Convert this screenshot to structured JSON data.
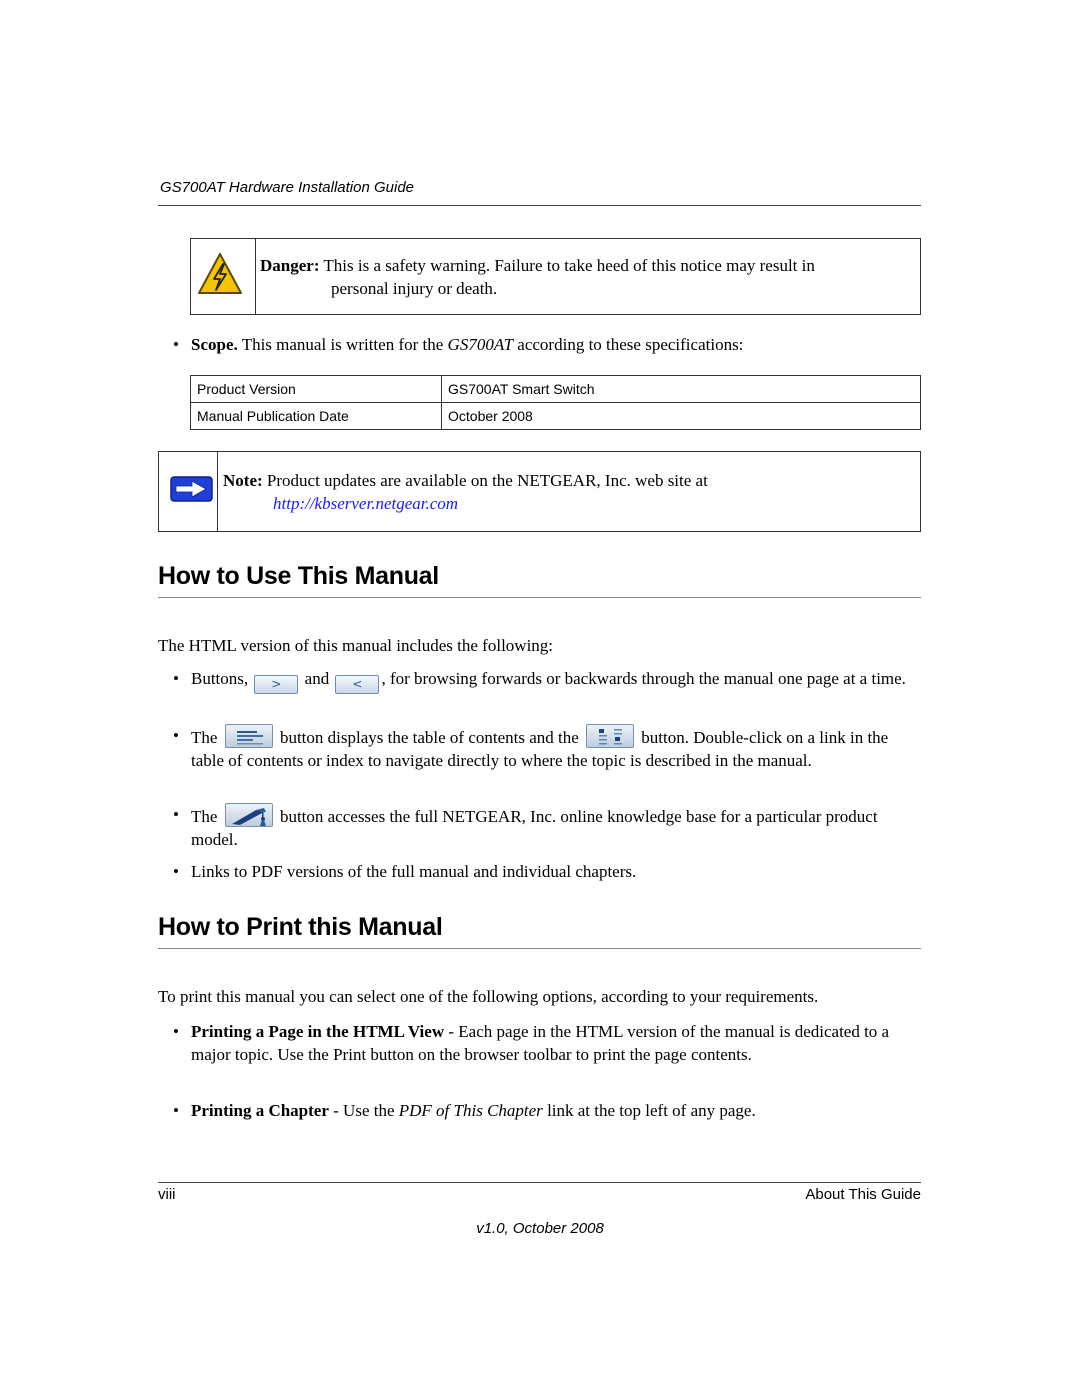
{
  "header": {
    "title": "GS700AT Hardware Installation Guide"
  },
  "danger": {
    "icon": "high-voltage-warning-icon",
    "label": "Danger:",
    "line1": " This is a safety warning. Failure to take heed of this notice may result in",
    "line2": "personal injury or death."
  },
  "scope": {
    "bullet": "•",
    "label": "Scope.",
    "text_before": " This manual is written for the ",
    "product": "GS700AT",
    "text_after": " according to these specifications:"
  },
  "spec_table": {
    "rows": [
      {
        "label": "Product Version",
        "value": "GS700AT Smart Switch"
      },
      {
        "label": "Manual Publication Date",
        "value": "October 2008"
      }
    ]
  },
  "note": {
    "icon": "arrow-right-icon",
    "label": "Note:",
    "text": " Product updates are available on the NETGEAR, Inc. web site at",
    "link": "http://kbserver.netgear.com"
  },
  "section_use": {
    "heading": "How to Use This Manual",
    "intro": "The HTML version of this manual includes the following:",
    "bullet": "•",
    "item1": {
      "before": "Buttons, ",
      "next_button": ">",
      "middle": " and ",
      "prev_button": "<",
      "after": ", for browsing forwards or backwards through the manual one page at a time."
    },
    "item2": {
      "before": "The ",
      "toc_icon": "table-of-contents-icon",
      "middle": " button displays the table of contents and the ",
      "index_icon": "index-icon",
      "after": " button. Double-click on a link in the table of contents or index to navigate directly to where the topic is described in the manual."
    },
    "item3": {
      "before": "The ",
      "kb_icon": "knowledge-base-icon",
      "after": " button accesses the full NETGEAR, Inc. online knowledge base for a particular product model."
    },
    "item4": "Links to PDF versions of the full manual and individual chapters."
  },
  "section_print": {
    "heading": "How to Print this Manual",
    "intro": "To print this manual you can select one of the following options, according to your requirements.",
    "bullet": "•",
    "item1": {
      "label": "Printing a Page in the HTML View",
      "text": " - Each page in the HTML version of the manual is dedicated to a major topic. Use the Print button on the browser toolbar to print the page contents."
    },
    "item2": {
      "label": "Printing a Chapter",
      "before": " - Use the ",
      "link_name": "PDF of This Chapter",
      "after": " link at the top left of any page."
    }
  },
  "footer": {
    "page_number": "viii",
    "chapter": "About This Guide",
    "version": "v1.0, October 2008"
  }
}
